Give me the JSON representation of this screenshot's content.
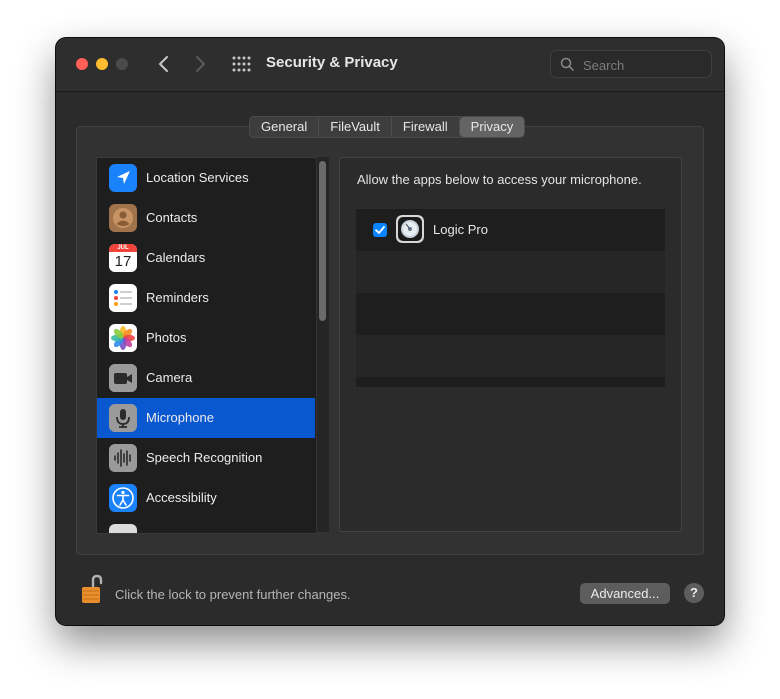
{
  "window": {
    "title": "Security & Privacy",
    "search_placeholder": "Search"
  },
  "tabs": [
    {
      "label": "General",
      "active": false
    },
    {
      "label": "FileVault",
      "active": false
    },
    {
      "label": "Firewall",
      "active": false
    },
    {
      "label": "Privacy",
      "active": true
    }
  ],
  "sidebar": {
    "items": [
      {
        "label": "Location Services",
        "icon": "location-icon"
      },
      {
        "label": "Contacts",
        "icon": "contacts-icon"
      },
      {
        "label": "Calendars",
        "icon": "calendar-icon",
        "icon_month": "JUL",
        "icon_day": "17"
      },
      {
        "label": "Reminders",
        "icon": "reminders-icon"
      },
      {
        "label": "Photos",
        "icon": "photos-icon"
      },
      {
        "label": "Camera",
        "icon": "camera-icon"
      },
      {
        "label": "Microphone",
        "icon": "microphone-icon",
        "selected": true
      },
      {
        "label": "Speech Recognition",
        "icon": "speech-icon"
      },
      {
        "label": "Accessibility",
        "icon": "accessibility-icon"
      }
    ]
  },
  "panel": {
    "description": "Allow the apps below to access your microphone.",
    "apps": [
      {
        "name": "Logic Pro",
        "checked": true,
        "icon": "logic-pro-icon"
      }
    ]
  },
  "footer": {
    "lock_text": "Click the lock to prevent further changes.",
    "advanced_label": "Advanced...",
    "help_label": "?"
  },
  "colors": {
    "selection": "#0a58d0",
    "checkbox": "#0a84ff",
    "close": "#ff5f57",
    "minimize": "#febc2e"
  }
}
